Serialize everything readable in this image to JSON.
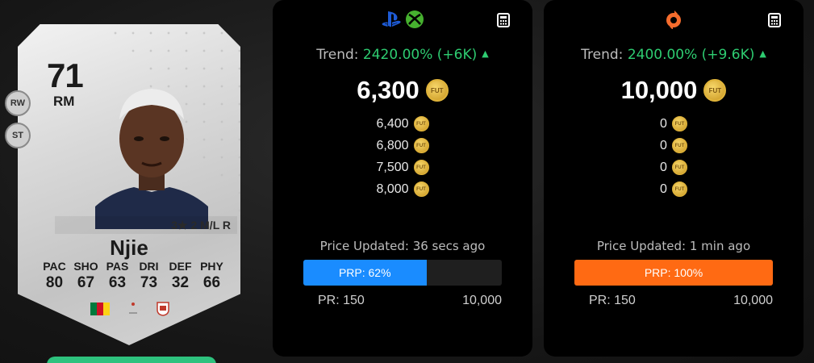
{
  "player_card": {
    "rating": "71",
    "position": "RM",
    "alt_positions": [
      "RW",
      "ST"
    ],
    "skill_line": "3★ 2 M/L R",
    "name": "Njie",
    "stats": [
      {
        "label": "PAC",
        "value": "80"
      },
      {
        "label": "SHO",
        "value": "67"
      },
      {
        "label": "PAS",
        "value": "63"
      },
      {
        "label": "DRI",
        "value": "73"
      },
      {
        "label": "DEF",
        "value": "32"
      },
      {
        "label": "PHY",
        "value": "66"
      }
    ],
    "nation_icon": "cameroon-flag",
    "league_icon": "league-logo",
    "club_icon": "club-crest"
  },
  "coin_icon_text": "FUT",
  "panels": {
    "console": {
      "platform_icons": [
        "playstation-icon",
        "xbox-icon"
      ],
      "trend_label": "Trend:",
      "trend_value": "2420.00% (+6K)",
      "main_price": "6,300",
      "other_prices": [
        "6,400",
        "6,800",
        "7,500",
        "8,000"
      ],
      "updated": "Price Updated: 36 secs ago",
      "prp_label": "PRP: 62%",
      "prp_percent": 62,
      "prp_color": "#1a8cff",
      "pr_min": "PR: 150",
      "pr_max": "10,000"
    },
    "pc": {
      "platform_icons": [
        "origin-icon"
      ],
      "trend_label": "Trend:",
      "trend_value": "2400.00% (+9.6K)",
      "main_price": "10,000",
      "other_prices": [
        "0",
        "0",
        "0",
        "0"
      ],
      "updated": "Price Updated: 1 min ago",
      "prp_label": "PRP: 100%",
      "prp_percent": 100,
      "prp_color": "#ff6a13",
      "pr_min": "PR: 150",
      "pr_max": "10,000"
    }
  },
  "colors": {
    "trend_green": "#2ecc71",
    "panel_bg": "#000000",
    "coin_gold": "#e0b43a"
  }
}
